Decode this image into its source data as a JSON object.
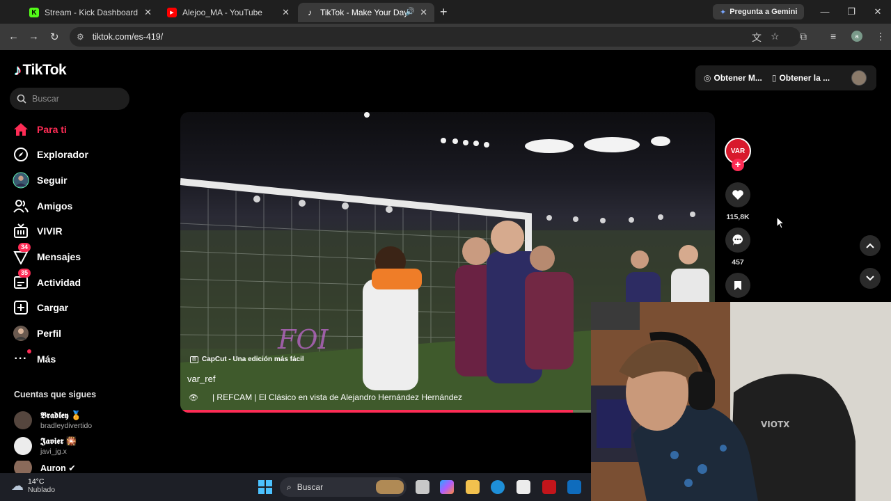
{
  "browser": {
    "tabs": [
      {
        "title": "Stream - Kick Dashboard",
        "favicon": "kick-icon",
        "color": "#53fc18"
      },
      {
        "title": "Alejoo_MA - YouTube",
        "favicon": "youtube-icon",
        "color": "#ff0000"
      },
      {
        "title": "TikTok - Make Your Day",
        "favicon": "tiktok-icon",
        "color": "#ffffff",
        "active": true
      }
    ],
    "gemini_button": "Pregunta a Gemini",
    "url": "tiktok.com/es-419/"
  },
  "tiktok": {
    "logo": "TikTok",
    "search_placeholder": "Buscar",
    "nav": [
      {
        "label": "Para ti",
        "icon": "home-icon",
        "active": true
      },
      {
        "label": "Explorador",
        "icon": "compass-icon"
      },
      {
        "label": "Seguir",
        "icon": "following-avatar-icon"
      },
      {
        "label": "Amigos",
        "icon": "friends-icon"
      },
      {
        "label": "VIVIR",
        "icon": "live-icon"
      },
      {
        "label": "Mensajes",
        "icon": "messages-icon",
        "badge": "34"
      },
      {
        "label": "Actividad",
        "icon": "activity-icon",
        "badge": "35"
      },
      {
        "label": "Cargar",
        "icon": "upload-icon"
      },
      {
        "label": "Perfil",
        "icon": "profile-avatar-icon"
      },
      {
        "label": "Más",
        "icon": "more-icon"
      }
    ],
    "following_title": "Cuentas que sigues",
    "following": [
      {
        "name": "𝕭𝖗𝖆𝖉𝖑𝖊𝖞 🏅",
        "handle": "bradleydivertido"
      },
      {
        "name": "𝕵𝖆𝖛𝖎𝖊𝖗 🎇",
        "handle": "javi_jg.x"
      },
      {
        "name": "Auron ✔",
        "handle": ""
      }
    ],
    "topright": {
      "item1": "Obtener M...",
      "item2": "Obtener la ..."
    },
    "video": {
      "watermark": "CapCut - Una edición más fácil",
      "username": "var_ref",
      "description": "| REFCAM | El Clásico en vista de Alejandro Hernández Hernández",
      "progress": 0.735
    },
    "creator_avatar_text": "VAR",
    "likes": "115,8K",
    "comments": "457"
  },
  "taskbar": {
    "temperature": "14°C",
    "weather": "Nublado",
    "search": "Buscar"
  }
}
